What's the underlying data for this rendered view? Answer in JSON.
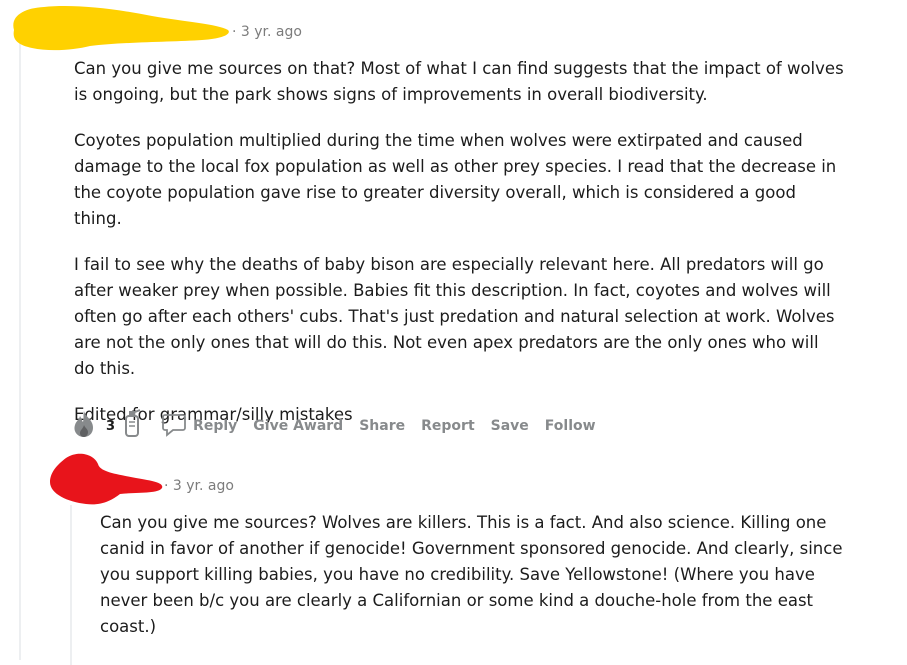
{
  "comment_1": {
    "timestamp": "3 yr. ago",
    "paragraphs": [
      "Can you give me sources on that? Most of what I can find suggests that the impact of wolves is ongoing, but the park shows signs of improvements in overall biodiversity.",
      "Coyotes population multiplied during the time when wolves were extirpated and caused damage to the local fox population as well as other prey species. I read that the decrease in the coyote population gave rise to greater diversity overall, which is considered a good thing.",
      "I fail to see why the deaths of baby bison are especially relevant here. All predators will go after weaker prey when possible. Babies fit this description. In fact, coyotes and wolves will often go after each others' cubs. That's just predation and natural selection at work. Wolves are not the only ones that will do this. Not even apex predators are the only ones who will do this.",
      "Edited for grammar/silly mistakes"
    ],
    "vote_count": "3",
    "actions": {
      "reply": "Reply",
      "give_award": "Give Award",
      "share": "Share",
      "report": "Report",
      "save": "Save",
      "follow": "Follow"
    }
  },
  "comment_2": {
    "timestamp": "3 yr. ago",
    "paragraphs": [
      "Can you give me sources? Wolves are killers. This is a fact. And also science. Killing one canid in favor of another if genocide! Government sponsored genocide. And clearly, since you support killing babies, you have no credibility. Save Yellowstone! (Where you have never been b/c you are clearly a Californian or some kind a douche-hole from the east coast.)"
    ]
  },
  "colors": {
    "redaction_1": "#ffd100",
    "redaction_2": "#e8141b",
    "meta_text": "#7c7c7c",
    "action_text": "#878a8c",
    "thread_line": "#edeff1"
  },
  "icons": [
    "fire-icon",
    "rocket-icon",
    "comment-icon"
  ]
}
